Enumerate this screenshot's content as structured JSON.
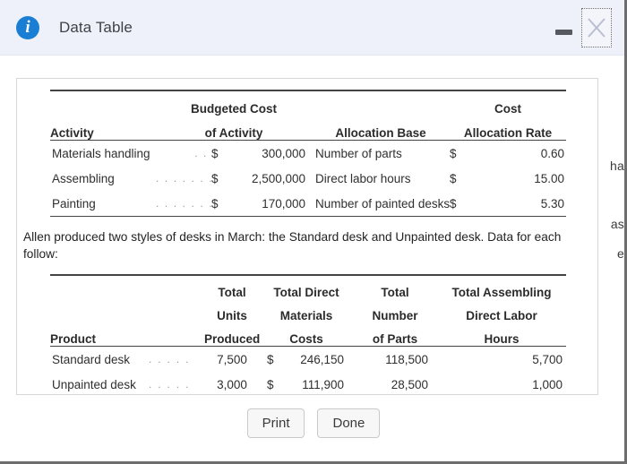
{
  "window": {
    "title": "Data Table",
    "info_icon": "info-icon",
    "minimize_label": "Minimize",
    "close_label": "Close"
  },
  "background_text": {
    "line1": "ha",
    "line2": "as",
    "line3": "e"
  },
  "table1": {
    "header_row1": [
      "",
      "Budgeted Cost",
      "",
      "Cost"
    ],
    "header_row2": [
      "Activity",
      "of Activity",
      "Allocation Base",
      "Allocation Rate"
    ],
    "rows": [
      {
        "activity": "Materials handling",
        "leader": ". .",
        "currency": "$",
        "budgeted_cost": "300,000",
        "allocation_base": "Number of parts",
        "rate_currency": "$",
        "allocation_rate": "0.60"
      },
      {
        "activity": "Assembling",
        "leader": ". . . . . . .",
        "currency": "$",
        "budgeted_cost": "2,500,000",
        "allocation_base": "Direct labor hours",
        "rate_currency": "$",
        "allocation_rate": "15.00"
      },
      {
        "activity": "Painting",
        "leader": ". . . . . . . . .",
        "currency": "$",
        "budgeted_cost": "170,000",
        "allocation_base": "Number of painted desks",
        "rate_currency": "$",
        "allocation_rate": "5.30"
      }
    ]
  },
  "narrative": "Allen produced two styles of desks in March: the Standard desk and Unpainted desk. Data for each follow:",
  "table2": {
    "header_row1": [
      "",
      "Total",
      "Total Direct",
      "Total",
      "Total Assembling"
    ],
    "header_row2": [
      "",
      "Units",
      "Materials",
      "Number",
      "Direct Labor"
    ],
    "header_row3": [
      "Product",
      "Produced",
      "Costs",
      "of Parts",
      "Hours"
    ],
    "rows": [
      {
        "product": "Standard desk",
        "leader": ". . . . .",
        "units_produced": "7,500",
        "currency": "$",
        "direct_materials_costs": "246,150",
        "number_of_parts": "118,500",
        "assembling_dl_hours": "5,700"
      },
      {
        "product": "Unpainted desk",
        "leader": ". . . . .",
        "units_produced": "3,000",
        "currency": "$",
        "direct_materials_costs": "111,900",
        "number_of_parts": "28,500",
        "assembling_dl_hours": "1,000"
      }
    ]
  },
  "footer": {
    "print_label": "Print",
    "done_label": "Done"
  },
  "colors": {
    "titlebar_bg": "#eef1fa",
    "info_blue": "#1a7fd4",
    "rule": "#444444",
    "text": "#2f2f2f",
    "leader_dots": "#9a9a9a",
    "card_border": "#d8d8d8",
    "button_bg": "#f7f7f7"
  }
}
